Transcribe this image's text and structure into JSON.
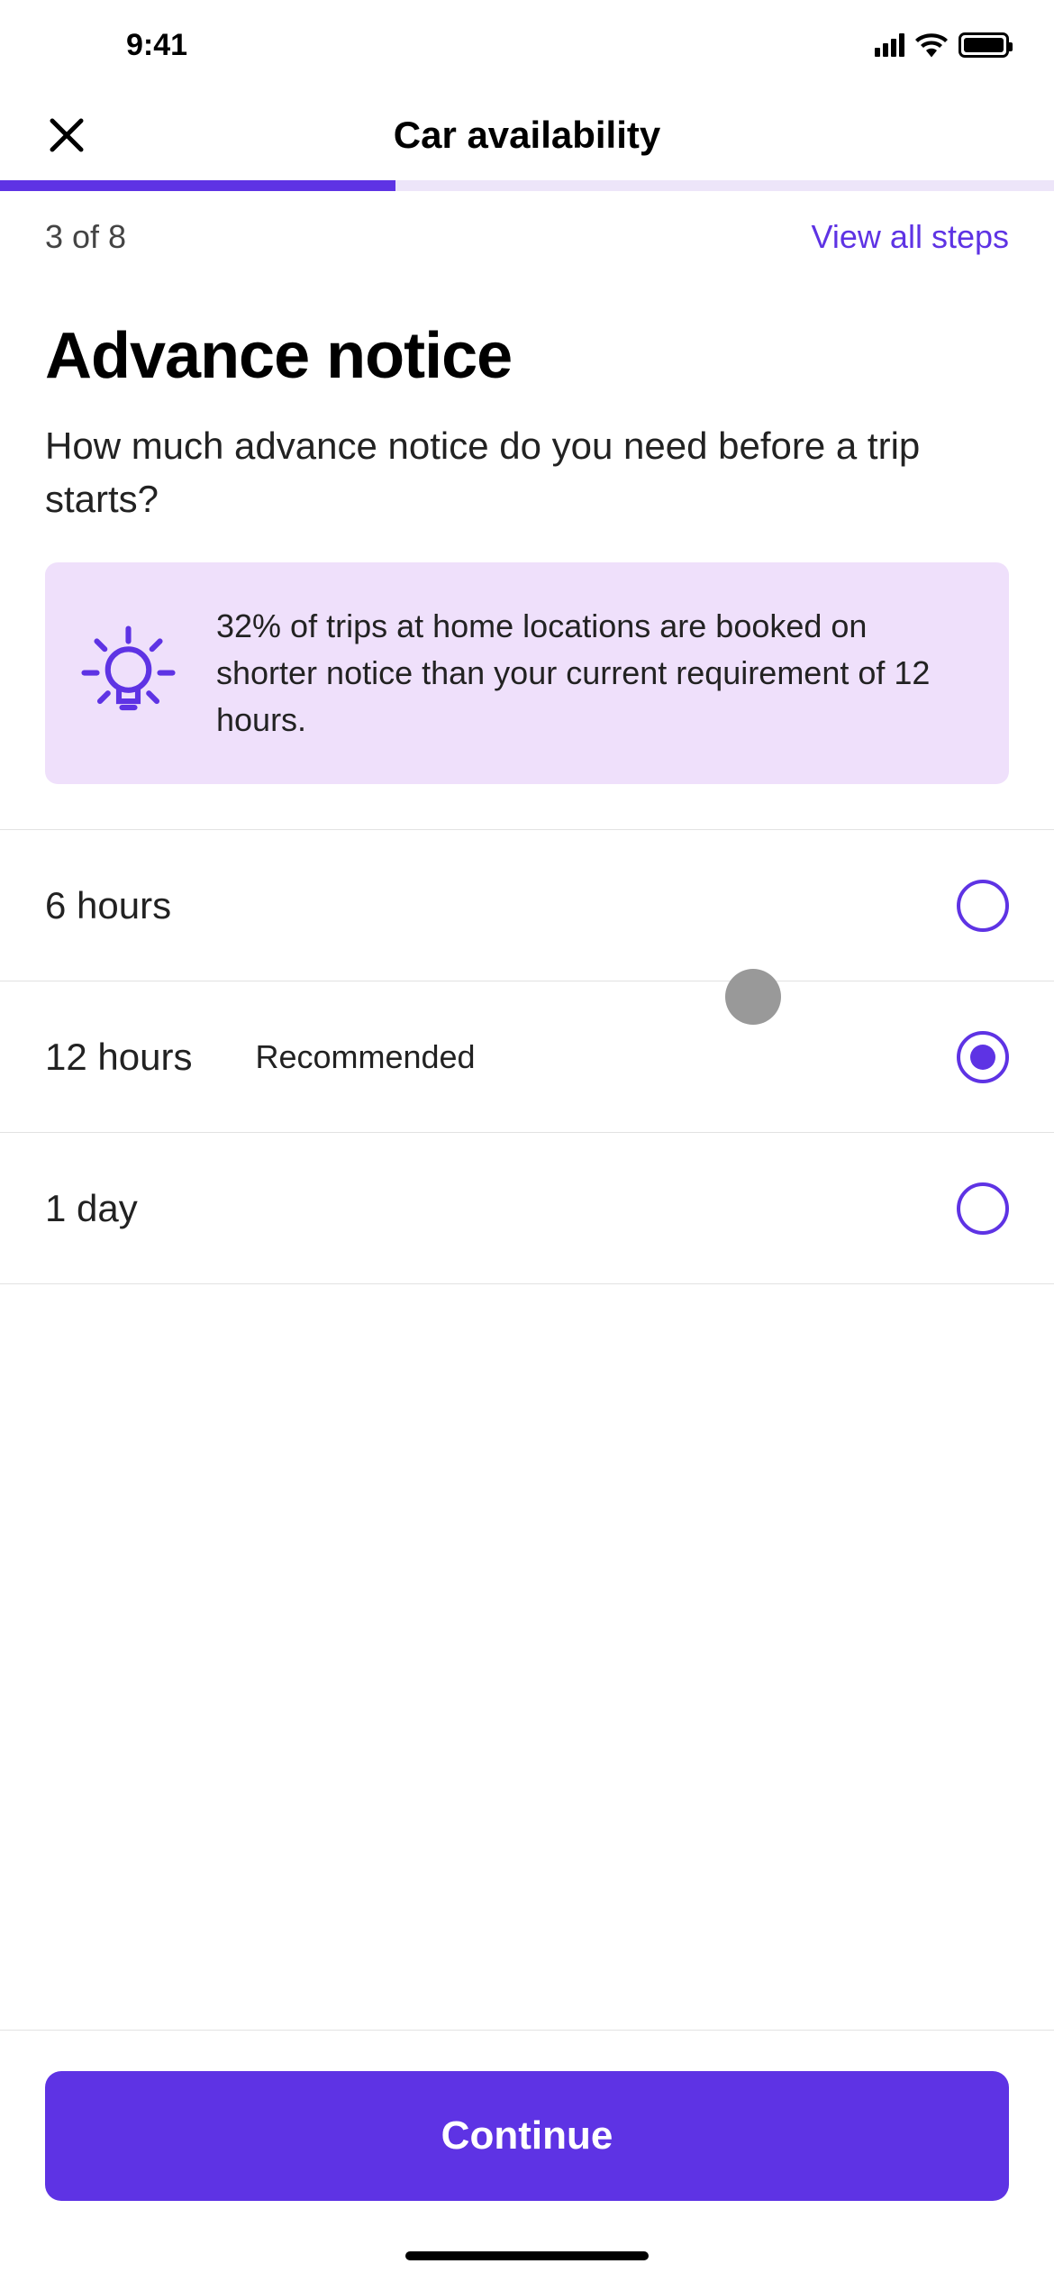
{
  "status": {
    "time": "9:41"
  },
  "header": {
    "title": "Car availability"
  },
  "progress": {
    "step_text": "3 of 8",
    "view_all": "View all steps"
  },
  "main": {
    "title": "Advance notice",
    "subtitle": "How much advance notice do you need before a trip starts?"
  },
  "info": {
    "text": "32% of trips at home locations are booked on shorter notice than your current requirement of 12 hours."
  },
  "options": [
    {
      "label": "6 hours",
      "badge": "",
      "selected": false
    },
    {
      "label": "12 hours",
      "badge": "Recommended",
      "selected": true
    },
    {
      "label": "1 day",
      "badge": "",
      "selected": false
    }
  ],
  "footer": {
    "continue": "Continue"
  }
}
